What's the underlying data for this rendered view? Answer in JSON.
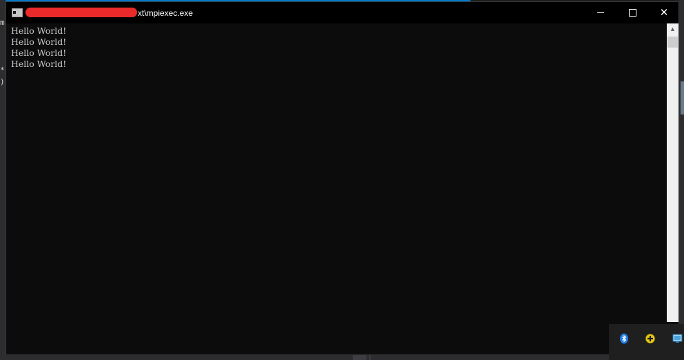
{
  "window": {
    "title_suffix": "xt\\mpiexec.exe",
    "controls": {
      "minimize": "minimize",
      "maximize": "maximize",
      "close": "✕"
    }
  },
  "console": {
    "lines": [
      "Hello World!",
      "Hello World!",
      "Hello World!",
      "Hello World!"
    ]
  },
  "background_editor": {
    "gutter_fragments": [
      "m",
      "*",
      ")"
    ]
  },
  "scrollbar": {
    "up_arrow": "▲"
  },
  "tray": {
    "icons": [
      "bluetooth-icon",
      "add-icon",
      "network-icon"
    ]
  },
  "colors": {
    "console_bg": "#0c0c0c",
    "console_text": "#cccccc",
    "titlebar_bg": "#000000",
    "accent_blue": "#007acc",
    "redaction": "#ea2a2a"
  }
}
